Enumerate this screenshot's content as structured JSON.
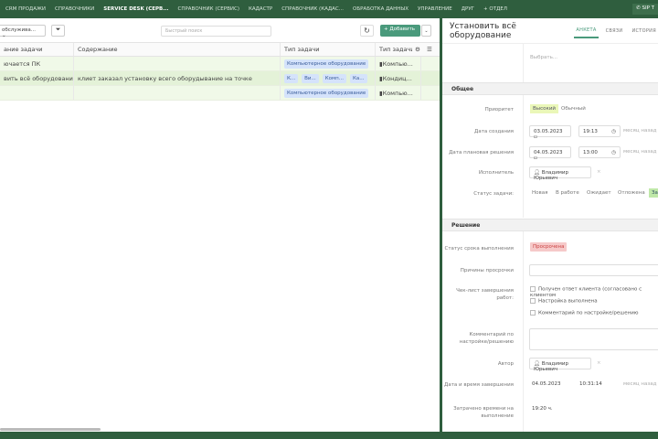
{
  "nav": {
    "items": [
      "CRM ПРОДАЖИ",
      "СПРАВОЧНИКИ",
      "SERVICE DESK (СЕРВ...",
      "СПРАВОЧНИК (СЕРВИС)",
      "КАДАСТР",
      "СПРАВОЧНИК (КАДАС...",
      "ОБРАБОТКА ДАННЫХ",
      "УПРАВЛЕНИЕ",
      "ДРУГ",
      "+ ОТДЕЛ"
    ],
    "sip": "SIP Т"
  },
  "toolbar": {
    "filter_select": "обслужива...",
    "search_placeholder": "Быстрый поиск",
    "add_label": "+ Добавить"
  },
  "table": {
    "headers": [
      "ание задачи",
      "Содержание",
      "Тип задачи",
      "Тип задачи"
    ],
    "rows": [
      {
        "name": "ючается ПК",
        "content": "",
        "tags": [
          "Компьютерное оборудование"
        ],
        "type2": "Компью..."
      },
      {
        "name": "вить всё оборудование",
        "content": "клиет заказал установку всего оборудывание на точке",
        "tags": [
          "К...",
          "Ви...",
          "Комп...",
          "Ка..."
        ],
        "type2": "Кондиц..."
      },
      {
        "name": "",
        "content": "",
        "tags": [
          "Компьютерное оборудование"
        ],
        "type2": "Компью..."
      }
    ]
  },
  "detail": {
    "title": "Установить всё оборудование",
    "tabs": [
      "АНКЕТА",
      "СВЯЗИ",
      "ИСТОРИЯ"
    ],
    "choose": "Выбрать...",
    "general": {
      "header": "Общее",
      "priority_label": "Приоритет",
      "priority_options": [
        "Высокий",
        "Обычный"
      ],
      "created_label": "Дата создания",
      "created_date": "03.05.2023",
      "created_time": "19:13",
      "created_ago": "месяц назад",
      "planned_label": "Дата плановая решения",
      "planned_date": "04.05.2023",
      "planned_time": "13:00",
      "planned_ago": "месяц назад",
      "assignee_label": "Исполнитель",
      "assignee": "Владимир Юрьевич",
      "status_label": "Статус задачи:",
      "statuses": [
        "Новая",
        "В работе",
        "Ожидает",
        "Отложена",
        "За"
      ]
    },
    "solution": {
      "header": "Решение",
      "deadline_label": "Статус срока выполнения",
      "deadline_status": "Просрочена",
      "reasons_label": "Причины просрочки",
      "checklist_label": "Чек-лист завершения работ:",
      "checklist": [
        "Получен ответ клиента (согласовано с клиентом",
        "Настройка выполнена",
        "Комментарий по настройке/решению"
      ],
      "comment_label": "Комментарий по настройке/решению",
      "author_label": "Автор",
      "author": "Владимир Юрьевич",
      "completed_label": "Дата и время завершения",
      "completed_date": "04.05.2023",
      "completed_time": "10:31:14",
      "completed_ago": "месяц назад",
      "spent_label": "Затрачено времени на выполнение",
      "spent": "19:20 ч."
    }
  }
}
